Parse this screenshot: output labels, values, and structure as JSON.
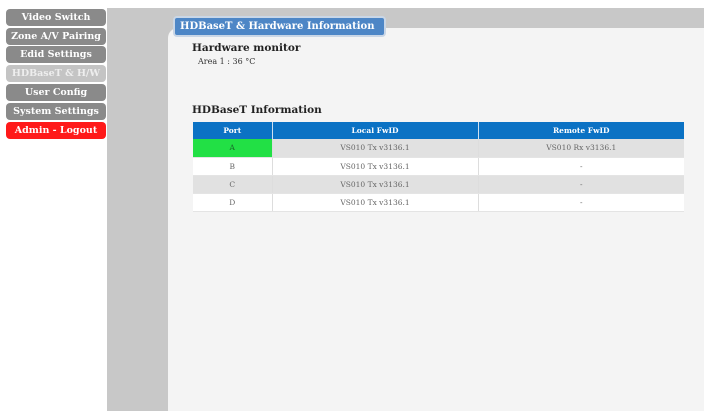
{
  "nav": {
    "items": [
      {
        "label": "Video Switch",
        "state": "normal"
      },
      {
        "label": "Zone A/V Pairing",
        "state": "normal"
      },
      {
        "label": "Edid Settings",
        "state": "normal"
      },
      {
        "label": "HDBaseT & H/W",
        "state": "active"
      },
      {
        "label": "User Config",
        "state": "normal"
      },
      {
        "label": "System Settings",
        "state": "normal"
      },
      {
        "label": "Admin - Logout",
        "state": "logout"
      }
    ]
  },
  "panel": {
    "title": "HDBaseT & Hardware Information"
  },
  "hardware": {
    "heading": "Hardware monitor",
    "reading": "Area 1 : 36 °C"
  },
  "hdbaset": {
    "heading": "HDBaseT Information",
    "columns": [
      "Port",
      "Local FwID",
      "Remote FwID"
    ],
    "rows": [
      {
        "port": "A",
        "local": "VS010 Tx v3136.1",
        "remote": "VS010 Rx v3136.1",
        "connected": true
      },
      {
        "port": "B",
        "local": "VS010 Tx v3136.1",
        "remote": "-",
        "connected": false
      },
      {
        "port": "C",
        "local": "VS010 Tx v3136.1",
        "remote": "-",
        "connected": false
      },
      {
        "port": "D",
        "local": "VS010 Tx v3136.1",
        "remote": "-",
        "connected": false
      }
    ]
  },
  "colors": {
    "nav_normal": "#8a8a8a",
    "nav_active": "#c4c4c4",
    "nav_logout": "#ff1a1a",
    "tab_blue": "#4d86c6",
    "table_header": "#0b72c4",
    "port_connected": "#22e045"
  }
}
